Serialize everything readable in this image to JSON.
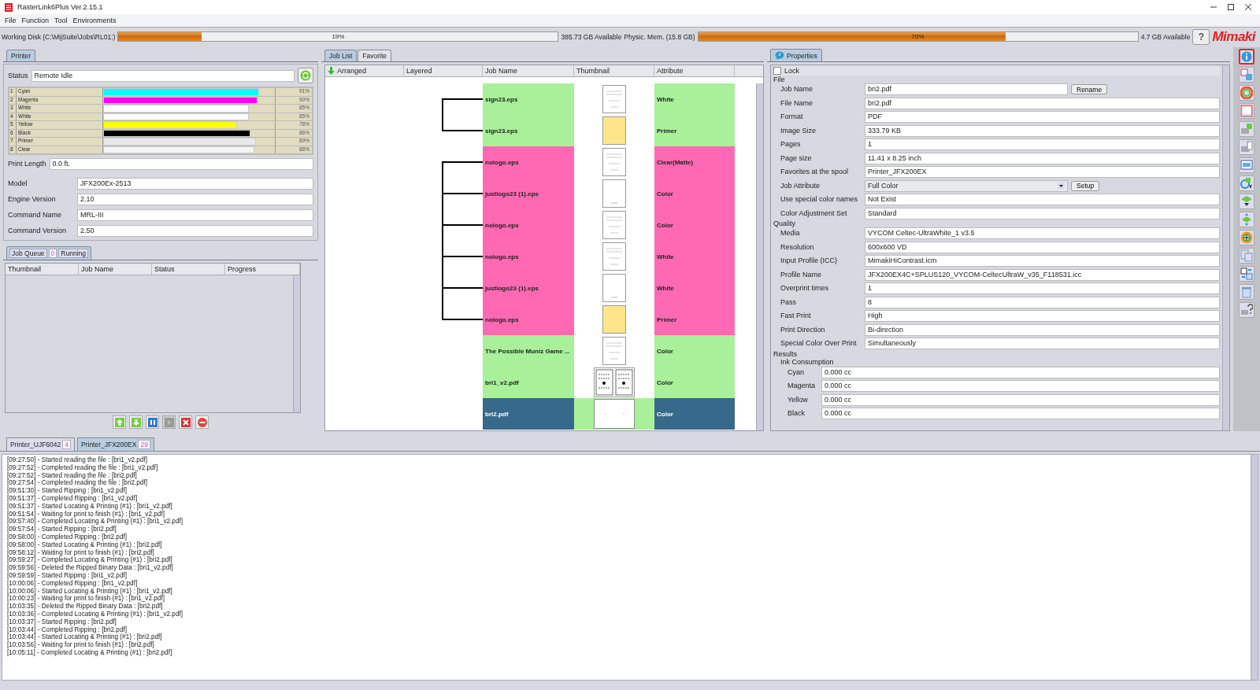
{
  "window": {
    "title": "RasterLink6Plus Ver.2.15.1"
  },
  "menu": [
    "File",
    "Function",
    "Tool",
    "Environments"
  ],
  "resources": {
    "disk": {
      "label": "Working Disk (C:\\MijSuite\\Jobs\\RL01:)",
      "level": 0.19,
      "reading": "19%",
      "available": "385.73 GB Available"
    },
    "memory": {
      "label": "Physic. Mem. (15.8 GB)",
      "level": 0.7,
      "reading": "70%",
      "available": "4.7 GB Available"
    },
    "help": "?",
    "logo": "Mimaki"
  },
  "printer_panel": {
    "tab": "Printer",
    "status_label": "Status",
    "status": "Remote Idle",
    "inks": [
      {
        "number": "1",
        "name": "Cyan",
        "level": 0.91,
        "reading": "91%",
        "color": "#00ffff"
      },
      {
        "number": "2",
        "name": "Magenta",
        "level": 0.9,
        "reading": "90%",
        "color": "#ff00ff"
      },
      {
        "number": "3",
        "name": "White",
        "level": 0.85,
        "reading": "85%",
        "color": "#ffffff"
      },
      {
        "number": "4",
        "name": "White",
        "level": 0.85,
        "reading": "85%",
        "color": "#ffffff"
      },
      {
        "number": "5",
        "name": "Yellow",
        "level": 0.78,
        "reading": "78%",
        "color": "#ffff00"
      },
      {
        "number": "6",
        "name": "Black",
        "level": 0.86,
        "reading": "86%",
        "color": "#000000"
      },
      {
        "number": "7",
        "name": "Primer",
        "level": 0.89,
        "reading": "89%",
        "color": "#e8e8e8"
      },
      {
        "number": "8",
        "name": "Clear",
        "level": 0.88,
        "reading": "88%",
        "color": "#f4f4f4"
      }
    ],
    "print_length_label": "Print Length",
    "print_length": "0.0 ft.",
    "info": [
      {
        "label": "Model",
        "value": "JFX200Ex-2513"
      },
      {
        "label": "Engine Version",
        "value": "2.10"
      },
      {
        "label": "Command Name",
        "value": "MRL-III"
      },
      {
        "label": "Command Version",
        "value": "2.50"
      }
    ]
  },
  "job_queue": {
    "tab": "Job Queue",
    "count": "0",
    "state": "Running",
    "columns": [
      "Thumbnail",
      "Job Name",
      "Status",
      "Progress"
    ],
    "buttons": [
      {
        "disabled": false
      },
      {
        "disabled": false
      },
      {
        "disabled": false
      },
      {
        "disabled": true
      },
      {
        "disabled": false
      },
      {
        "disabled": false
      }
    ]
  },
  "job_list": {
    "tabs": [
      {
        "label": "Job List",
        "selected": true
      },
      {
        "label": "Favorite",
        "selected": false
      }
    ],
    "columns": [
      "Arranged",
      "Layered",
      "Job Name",
      "Thumbnail",
      "Attribute"
    ],
    "rows": [
      {
        "children": [
          {
            "name": "sign23.eps",
            "attribute": "White",
            "color": "#a8f09a",
            "kind": "page",
            "selected": false
          },
          {
            "name": "sign23.eps",
            "attribute": "Primer",
            "color": "#a8f09a",
            "kind": "fill",
            "selected": false
          }
        ]
      },
      {
        "children": [
          {
            "name": "nologo.eps",
            "attribute": "Clear(Matte)",
            "color": "#ff69b4",
            "kind": "page",
            "selected": false
          },
          {
            "name": "justlogo23 (1).eps",
            "attribute": "Color",
            "color": "#ff69b4",
            "kind": "blank",
            "selected": false
          },
          {
            "name": "nologo.eps",
            "attribute": "Color",
            "color": "#ff69b4",
            "kind": "page",
            "selected": false
          },
          {
            "name": "nologo.eps",
            "attribute": "White",
            "color": "#ff69b4",
            "kind": "page",
            "selected": false
          },
          {
            "name": "justlogo23 (1).eps",
            "attribute": "White",
            "color": "#ff69b4",
            "kind": "blank",
            "selected": false
          },
          {
            "name": "nologo.eps",
            "attribute": "Primer",
            "color": "#ff69b4",
            "kind": "fill",
            "selected": false
          }
        ]
      },
      {
        "name": "The Possible Muniz Game ...",
        "attribute": "Color",
        "color": "#a8f09a",
        "kind": "page",
        "selected": false
      },
      {
        "name": "bri1_v2.pdf",
        "attribute": "Color",
        "color": "#a8f09a",
        "kind": "spread",
        "selected": false
      },
      {
        "name": "bri2.pdf",
        "attribute": "Color",
        "color": "#a8f09a",
        "kind": "wide",
        "selected": true
      }
    ]
  },
  "properties": {
    "tab": "Properties",
    "lock": {
      "label": "Lock",
      "checked": false
    },
    "sections": [
      {
        "title": "File",
        "fields": [
          {
            "label": "Job Name",
            "value": "bri2.pdf",
            "kind": "button",
            "button": "Rename"
          },
          {
            "label": "File Name",
            "value": "bri2.pdf",
            "kind": "text"
          },
          {
            "label": "Format",
            "value": "PDF",
            "kind": "text"
          },
          {
            "label": "Image Size",
            "value": "333.79 KB",
            "kind": "text"
          },
          {
            "label": "Pages",
            "value": "1",
            "kind": "text"
          },
          {
            "label": "Page size",
            "value": "11.41 x 8.25 inch",
            "kind": "text"
          },
          {
            "label": "Favorites at the spool",
            "value": "Printer_JFX200EX",
            "kind": "text"
          },
          {
            "label": "Job Attribute",
            "value": "Full Color",
            "kind": "select",
            "button": "Setup"
          },
          {
            "label": "Use special color names",
            "value": "Not Exist",
            "kind": "text"
          },
          {
            "label": "Color Adjustment Set",
            "value": "Standard",
            "kind": "text"
          }
        ]
      },
      {
        "title": "Quality",
        "fields": [
          {
            "label": "Media",
            "value": "VYCOM Celtec-UltraWhite_1 v3.5",
            "kind": "text"
          },
          {
            "label": "Resolution",
            "value": "600x600 VD",
            "kind": "text"
          },
          {
            "label": "Input Profile (ICC)",
            "value": "MimakiHiContrast.icm",
            "kind": "text"
          },
          {
            "label": "Profile Name",
            "value": "JFX200EX4C+SPLUS120_VYCOM-CeltecUltraW_v35_F118531.icc",
            "kind": "text"
          },
          {
            "label": "Overprint times",
            "value": "1",
            "kind": "text"
          },
          {
            "label": "Pass",
            "value": "8",
            "kind": "text"
          },
          {
            "label": "Fast Print",
            "value": "High",
            "kind": "text"
          },
          {
            "label": "Print Direction",
            "value": "Bi-direction",
            "kind": "text"
          },
          {
            "label": "Special Color Over Print",
            "value": "Simultaneously",
            "kind": "text"
          }
        ]
      },
      {
        "title": "Results",
        "subtitle": "Ink Consumption",
        "fields": [
          {
            "label": "Cyan",
            "value": "0.000 cc",
            "kind": "text"
          },
          {
            "label": "Magenta",
            "value": "0.000 cc",
            "kind": "text"
          },
          {
            "label": "Yellow",
            "value": "0.000 cc",
            "kind": "text"
          },
          {
            "label": "Black",
            "value": "0.000 cc",
            "kind": "text"
          }
        ]
      }
    ]
  },
  "toolbar": [
    {
      "selected": true
    },
    {
      "selected": false
    },
    {
      "selected": false
    },
    {
      "selected": false
    },
    {
      "selected": false
    },
    {
      "selected": false
    },
    {
      "selected": false
    },
    {
      "selected": false
    },
    {
      "selected": false
    },
    {
      "selected": false
    },
    {
      "selected": false
    },
    {
      "selected": false
    },
    {
      "selected": false
    },
    {
      "selected": false
    },
    {
      "selected": false
    }
  ],
  "printer_tabs": [
    {
      "label": "Printer_UJF6042",
      "count": "4",
      "selected": false
    },
    {
      "label": "Printer_JFX200EX",
      "count": "29",
      "selected": true
    }
  ],
  "log": [
    "[09:27:50] - Started reading the file : [bri1_v2.pdf]",
    "[09:27:52] - Completed reading the file : [bri1_v2.pdf]",
    "[09:27:52] - Started reading the file : [bri2.pdf]",
    "[09:27:54] - Completed reading the file : [bri2.pdf]",
    "[09:51:30] - Started Ripping : [bri1_v2.pdf]",
    "[09:51:37] - Completed Ripping : [bri1_v2.pdf]",
    "[09:51:37] - Started Locating & Printing (#1) : [bri1_v2.pdf]",
    "[09:51:54] - Waiting for print to finish (#1) : [bri1_v2.pdf]",
    "[09:57:40] - Completed Locating & Printing (#1) : [bri1_v2.pdf]",
    "[09:57:54] - Started Ripping : [bri2.pdf]",
    "[09:58:00] - Completed Ripping : [bri2.pdf]",
    "[09:58:00] - Started Locating & Printing (#1) : [bri2.pdf]",
    "[09:58:12] - Waiting for print to finish (#1) : [bri2.pdf]",
    "[09:59:27] - Completed Locating & Printing (#1) : [bri2.pdf]",
    "[09:59:56] - Deleted the Ripped Binary Data : [bri1_v2.pdf]",
    "[09:59:59] - Started Ripping : [bri1_v2.pdf]",
    "[10:00:06] - Completed Ripping : [bri1_v2.pdf]",
    "[10:00:06] - Started Locating & Printing (#1) : [bri1_v2.pdf]",
    "[10:00:23] - Waiting for print to finish (#1) : [bri1_v2.pdf]",
    "[10:03:35] - Deleted the Ripped Binary Data : [bri2.pdf]",
    "[10:03:36] - Completed Locating & Printing (#1) : [bri1_v2.pdf]",
    "[10:03:37] - Started Ripping : [bri2.pdf]",
    "[10:03:44] - Completed Ripping : [bri2.pdf]",
    "[10:03:44] - Started Locating & Printing (#1) : [bri2.pdf]",
    "[10:03:56] - Waiting for print to finish (#1) : [bri2.pdf]",
    "[10:05:11] - Completed Locating & Printing (#1) : [bri2.pdf]"
  ]
}
